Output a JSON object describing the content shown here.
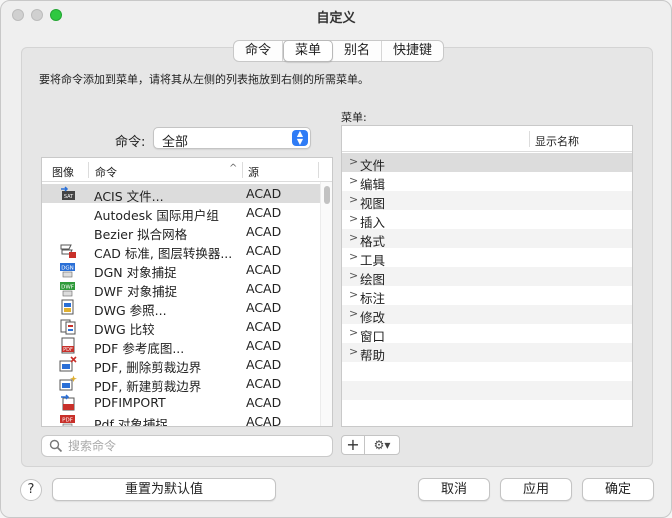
{
  "window": {
    "title": "自定义"
  },
  "tabs": [
    {
      "label": "命令",
      "selected": false
    },
    {
      "label": "菜单",
      "selected": true
    },
    {
      "label": "别名",
      "selected": false
    },
    {
      "label": "快捷键",
      "selected": false
    }
  ],
  "instruction": "要将命令添加到菜单，请将其从左侧的列表拖放到右侧的所需菜单。",
  "command_filter": {
    "label": "命令:",
    "value": "全部"
  },
  "command_table": {
    "headers": {
      "image": "图像",
      "command": "命令",
      "source": "源"
    },
    "rows": [
      {
        "icon": "acis-import-icon",
        "name": "ACIS 文件...",
        "source": "ACAD",
        "selected": true
      },
      {
        "icon": "",
        "name": "Autodesk 国际用户组",
        "source": "ACAD"
      },
      {
        "icon": "",
        "name": "Bezier 拟合网格",
        "source": "ACAD"
      },
      {
        "icon": "cad-standards-icon",
        "name": "CAD 标准, 图层转换器...",
        "source": "ACAD"
      },
      {
        "icon": "dgn-snap-icon",
        "name": "DGN 对象捕捉",
        "source": "ACAD"
      },
      {
        "icon": "dwf-snap-icon",
        "name": "DWF 对象捕捉",
        "source": "ACAD"
      },
      {
        "icon": "dwg-reference-icon",
        "name": "DWG 参照...",
        "source": "ACAD"
      },
      {
        "icon": "dwg-compare-icon",
        "name": "DWG 比较",
        "source": "ACAD"
      },
      {
        "icon": "pdf-underlay-icon",
        "name": "PDF 参考底图...",
        "source": "ACAD"
      },
      {
        "icon": "pdf-delete-clip-icon",
        "name": "PDF, 删除剪裁边界",
        "source": "ACAD"
      },
      {
        "icon": "pdf-new-clip-icon",
        "name": "PDF, 新建剪裁边界",
        "source": "ACAD"
      },
      {
        "icon": "pdf-import-icon",
        "name": "PDFIMPORT",
        "source": "ACAD"
      },
      {
        "icon": "pdf-snap-icon",
        "name": "Pdf 对象捕捉...",
        "source": "ACAD"
      }
    ]
  },
  "search": {
    "placeholder": "搜索命令",
    "value": ""
  },
  "menus": {
    "label": "菜单:",
    "column": "显示名称",
    "items": [
      "文件",
      "编辑",
      "视图",
      "插入",
      "格式",
      "工具",
      "绘图",
      "标注",
      "修改",
      "窗口",
      "帮助"
    ]
  },
  "toolbar": {
    "add": "+",
    "gear": "⚙▾"
  },
  "buttons": {
    "help": "?",
    "reset": "重置为默认值",
    "cancel": "取消",
    "apply": "应用",
    "ok": "确定"
  },
  "colors": {
    "accent": "#2f7cf6",
    "selected_row": "#dcdcdc",
    "pdf_red": "#c8302a",
    "icon_blue": "#2a6fd6"
  }
}
